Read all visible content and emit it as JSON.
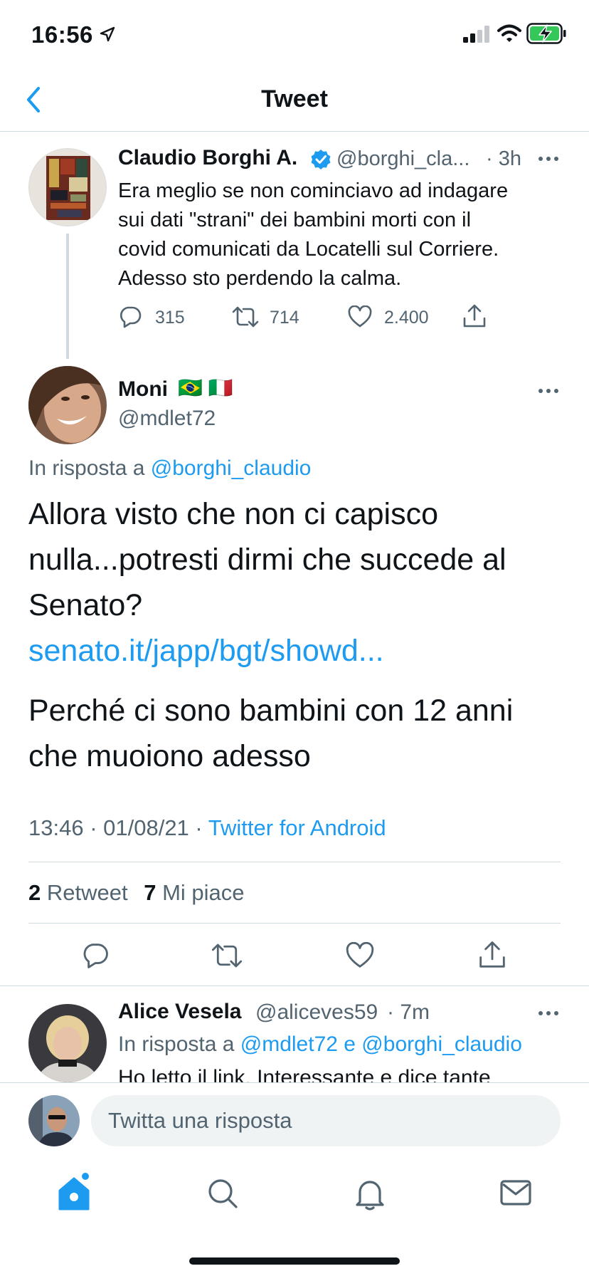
{
  "status": {
    "time": "16:56"
  },
  "nav": {
    "title": "Tweet"
  },
  "parent_tweet": {
    "name": "Claudio Borghi A.",
    "handle": "@borghi_cla...",
    "time": "· 3h",
    "text_lines": [
      "Era meglio se non cominciavo ad indagare",
      "sui dati \"strani\" dei bambini morti con il",
      "covid comunicati da Locatelli sul Corriere.",
      "Adesso sto perdendo la calma."
    ],
    "replies": "315",
    "retweets": "714",
    "likes": "2.400"
  },
  "main_tweet": {
    "name": "Moni",
    "flags": "🇧🇷 🇮🇹",
    "handle": "@mdlet72",
    "reply_prefix": "In risposta a",
    "reply_to": "@borghi_claudio",
    "text_lines": [
      "Allora visto che non ci capisco",
      "nulla...potresti dirmi che succede al",
      "Senato?"
    ],
    "link": "senato.it/japp/bgt/showd...",
    "text2_lines": [
      "Perché ci sono bambini con 12 anni",
      "che muoiono adesso"
    ],
    "timestamp": "13:46 · 01/08/21 ·",
    "source": "Twitter for Android",
    "retweet_count": "2",
    "retweet_label": "Retweet",
    "like_count": "7",
    "like_label": "Mi piace"
  },
  "reply_tweet": {
    "name": "Alice Vesela",
    "handle": "@aliceves59",
    "time": "· 7m",
    "reply_prefix": "In risposta a",
    "reply_to": "@mdlet72 e @borghi_claudio",
    "text_partial": "Ho letto il link. Interessante e dice tante"
  },
  "composer": {
    "placeholder": "Twitta una risposta"
  },
  "tabbar": {
    "items": [
      "home",
      "search",
      "notifications",
      "messages"
    ]
  },
  "colors": {
    "accent": "#1d9bf0",
    "text": "#0f1419",
    "muted": "#536471",
    "divider": "#cfd9de"
  }
}
